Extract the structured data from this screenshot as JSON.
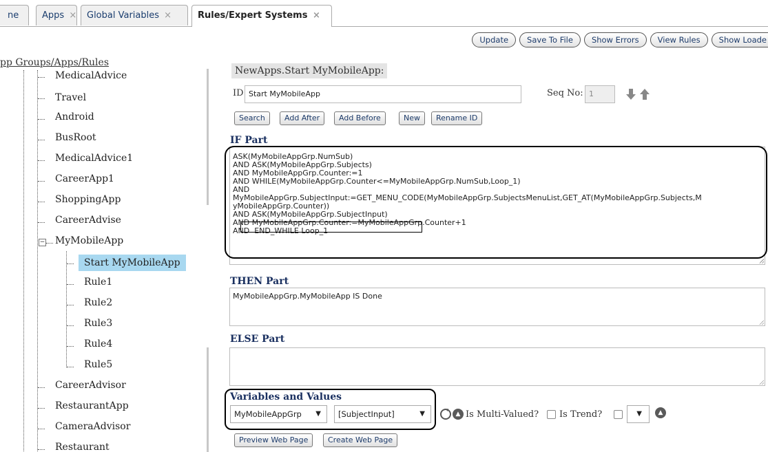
{
  "tabs": [
    {
      "label": "ne",
      "close": ""
    },
    {
      "label": "Apps",
      "close": "×"
    },
    {
      "label": "Global Variables",
      "close": "×"
    },
    {
      "label": "Rules/Expert Systems",
      "close": "×"
    }
  ],
  "toolbar": {
    "update": "Update",
    "save_to_file": "Save To File",
    "show_errors": "Show Errors",
    "view_rules": "View Rules",
    "show_loaded": "Show Loade"
  },
  "tree": {
    "root": "pp Groups/Apps/Rules",
    "items": [
      "MedicalAdvice",
      "Travel",
      "Android",
      "BusRoot",
      "MedicalAdvice1",
      "CareerApp1",
      "ShoppingApp",
      "CareerAdvise",
      "MyMobileApp"
    ],
    "children": [
      "Start MyMobileApp",
      "Rule1",
      "Rule2",
      "Rule3",
      "Rule4",
      "Rule5"
    ],
    "after": [
      "CareerAdvisor",
      "RestaurantApp",
      "CameraAdvisor",
      "Restaurant"
    ],
    "expander": "−"
  },
  "rule": {
    "header": "NewApps.Start MyMobileApp:",
    "id_label": "ID",
    "id_value": "Start MyMobileApp",
    "seq_label": "Seq No:",
    "seq_value": "1",
    "buttons": {
      "search": "Search",
      "add_after": "Add After",
      "add_before": "Add Before",
      "new": "New",
      "rename": "Rename ID"
    },
    "if_label": "IF Part",
    "if_lines": [
      "ASK(MyMobileAppGrp.NumSub)",
      "AND ASK(MyMobileAppGrp.Subjects)",
      "AND MyMobileAppGrp.Counter:=1",
      "AND WHILE(MyMobileAppGrp.Counter<=MyMobileAppGrp.NumSub,Loop_1)",
      "AND",
      "MyMobileAppGrp.SubjectInput:=GET_MENU_CODE(MyMobileAppGrp.SubjectsMenuList,GET_AT(MyMobileAppGrp.Subjects,M",
      "yMobileAppGrp.Counter))",
      "AND ASK(MyMobileAppGrp.SubjectInput)",
      "AND MyMobileAppGrp.Counter:=MyMobileAppGrp.Counter+1",
      "AND  END_WHILE Loop_1"
    ],
    "then_label": "THEN Part",
    "then_text": "MyMobileAppGrp.MyMobileApp IS Done",
    "else_label": "ELSE Part",
    "else_text": "",
    "vars_label": "Variables and Values",
    "group_select": "MyMobileAppGrp",
    "var_select": "[SubjectInput]",
    "multi_label": "Is Multi-Valued?",
    "trend_label": "Is Trend?",
    "preview_btn": "Preview Web Page",
    "create_btn": "Create Web Page"
  }
}
